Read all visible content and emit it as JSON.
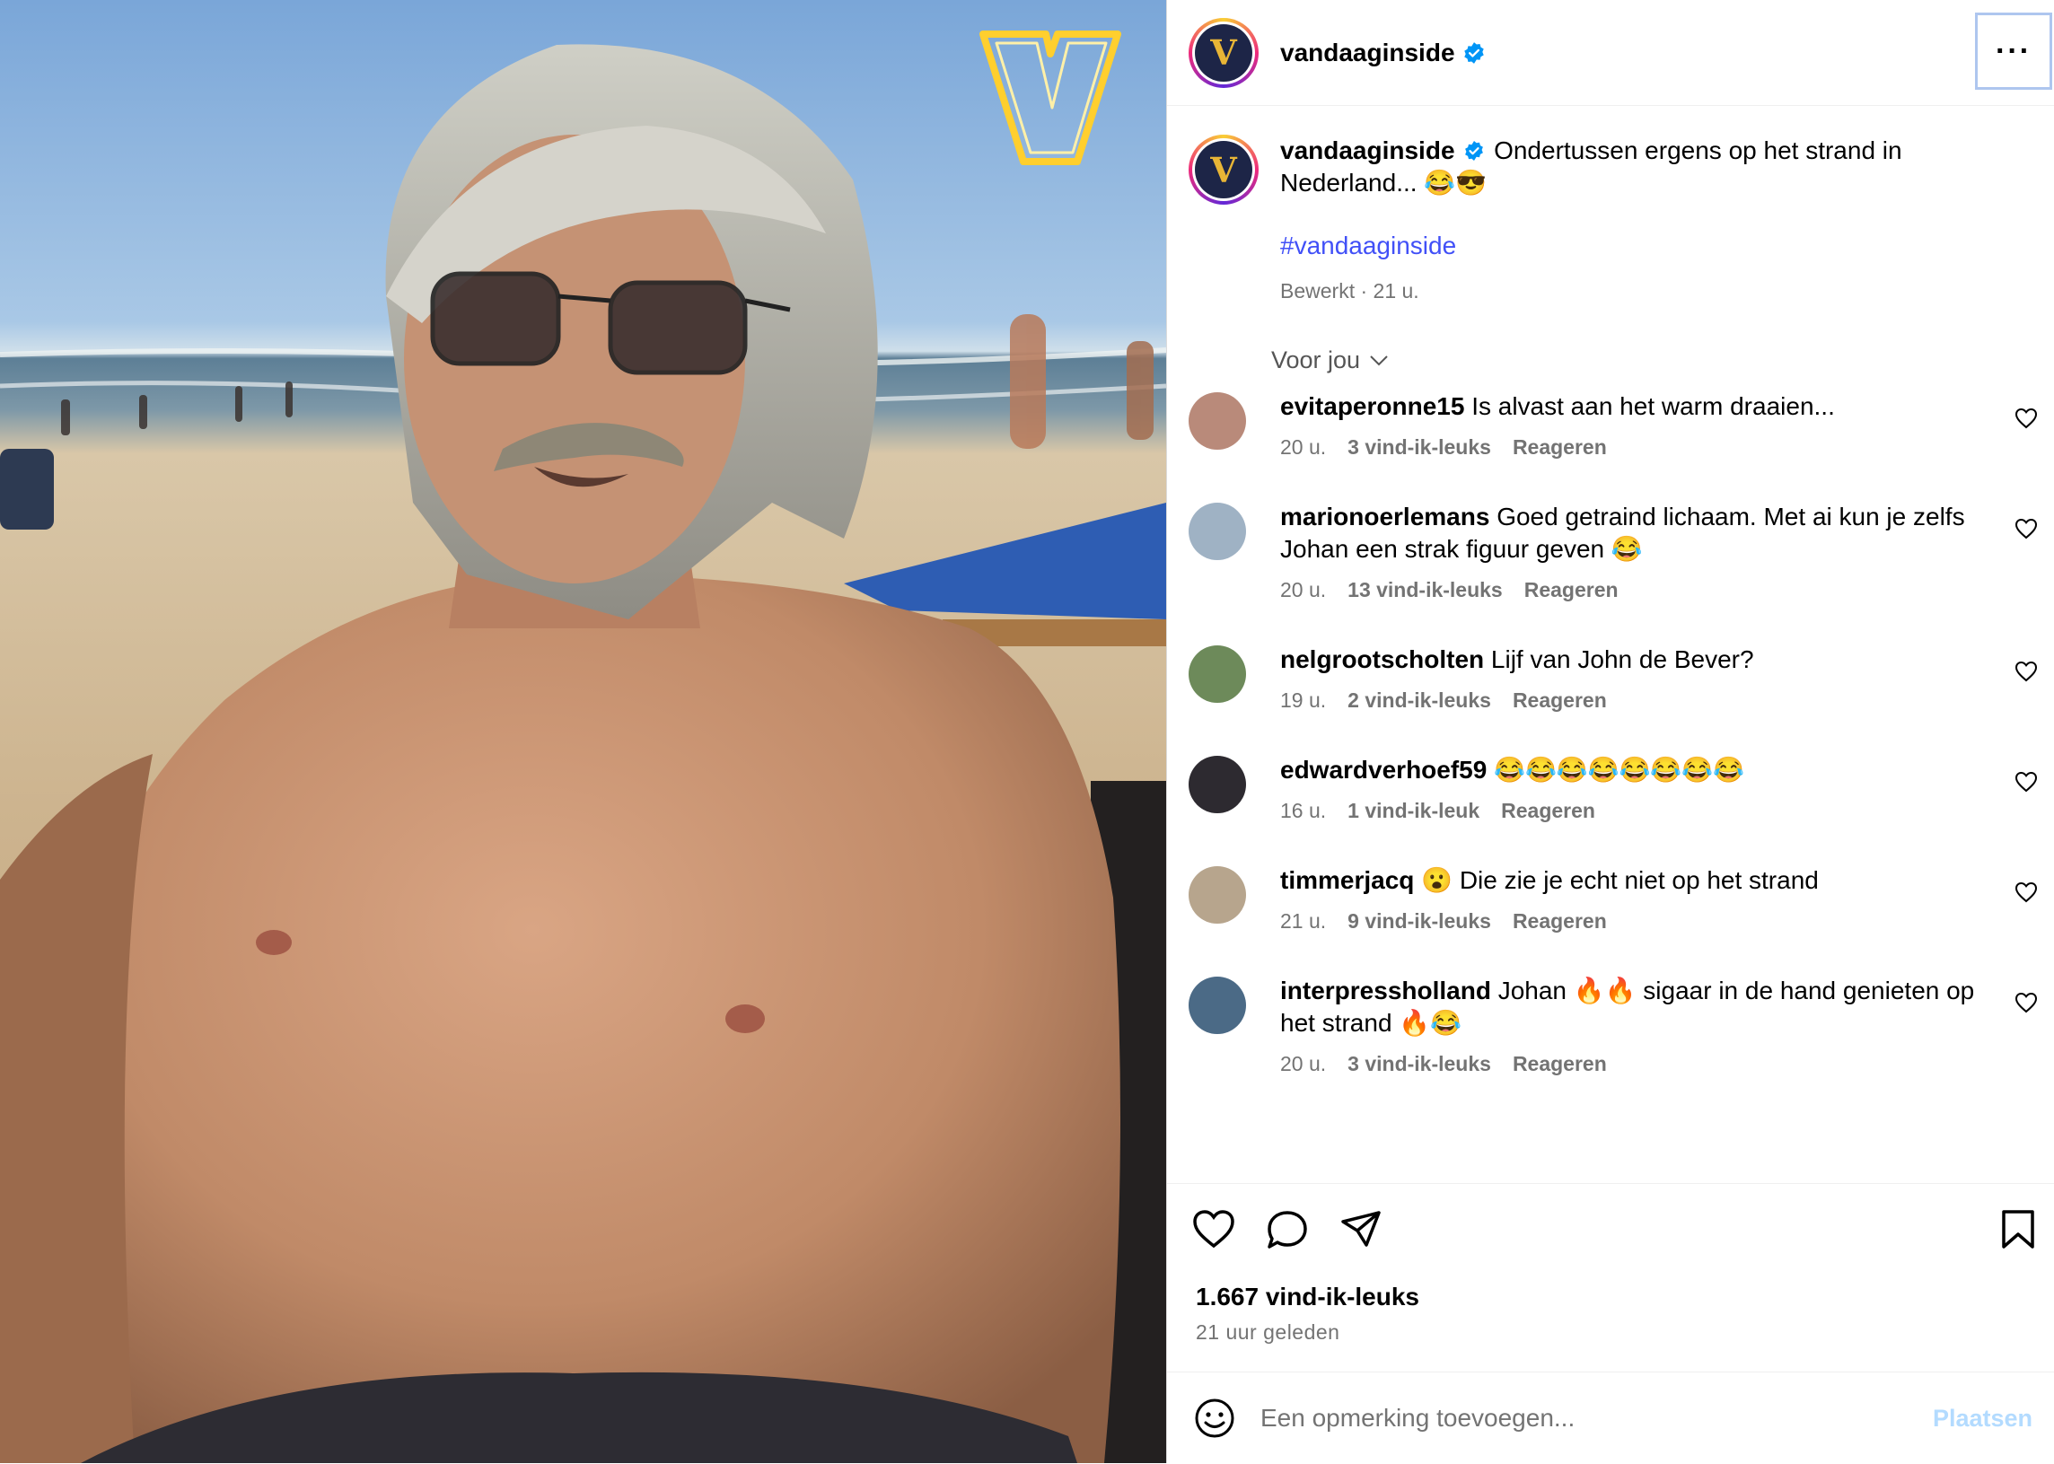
{
  "header": {
    "username": "vandaaginside",
    "more_label": "···"
  },
  "caption": {
    "username": "vandaaginside",
    "text": "Ondertussen ergens op het strand in Nederland... 😂😎",
    "hashtag": "#vandaaginside",
    "meta": "Bewerkt · 21 u."
  },
  "sort_label": "Voor jou",
  "comments": [
    {
      "user": "evitaperonne15",
      "text": "Is alvast aan het warm draaien...",
      "time": "20 u.",
      "likes": "3 vind-ik-leuks",
      "reply": "Reageren",
      "avatar_color": "#b98a7a"
    },
    {
      "user": "marionoerlemans",
      "text": "Goed getraind lichaam. Met ai kun je zelfs Johan een strak figuur geven 😂",
      "time": "20 u.",
      "likes": "13 vind-ik-leuks",
      "reply": "Reageren",
      "avatar_color": "#9fb2c4"
    },
    {
      "user": "nelgrootscholten",
      "text": "Lijf van John de Bever?",
      "time": "19 u.",
      "likes": "2 vind-ik-leuks",
      "reply": "Reageren",
      "avatar_color": "#6d8a5a"
    },
    {
      "user": "edwardverhoef59",
      "text": "😂😂😂😂😂😂😂😂",
      "time": "16 u.",
      "likes": "1 vind-ik-leuk",
      "reply": "Reageren",
      "avatar_color": "#2d2a30"
    },
    {
      "user": "timmerjacq",
      "text": "😮 Die zie je echt niet op het strand",
      "time": "21 u.",
      "likes": "9 vind-ik-leuks",
      "reply": "Reageren",
      "avatar_color": "#b7a58d"
    },
    {
      "user": "interpressholland",
      "text": "Johan 🔥🔥 sigaar in de hand genieten op het strand 🔥😂",
      "time": "20 u.",
      "likes": "3 vind-ik-leuks",
      "reply": "Reageren",
      "avatar_color": "#4b6a86"
    }
  ],
  "actions": {
    "likes": "1.667 vind-ik-leuks",
    "time": "21 uur geleden"
  },
  "add_comment": {
    "placeholder": "Een opmerking toevoegen...",
    "post_label": "Plaatsen"
  },
  "colors": {
    "link": "#4150f7",
    "verified": "#0095f6",
    "post_disabled": "#b3dbff",
    "logo_gold": "#e8b536"
  }
}
